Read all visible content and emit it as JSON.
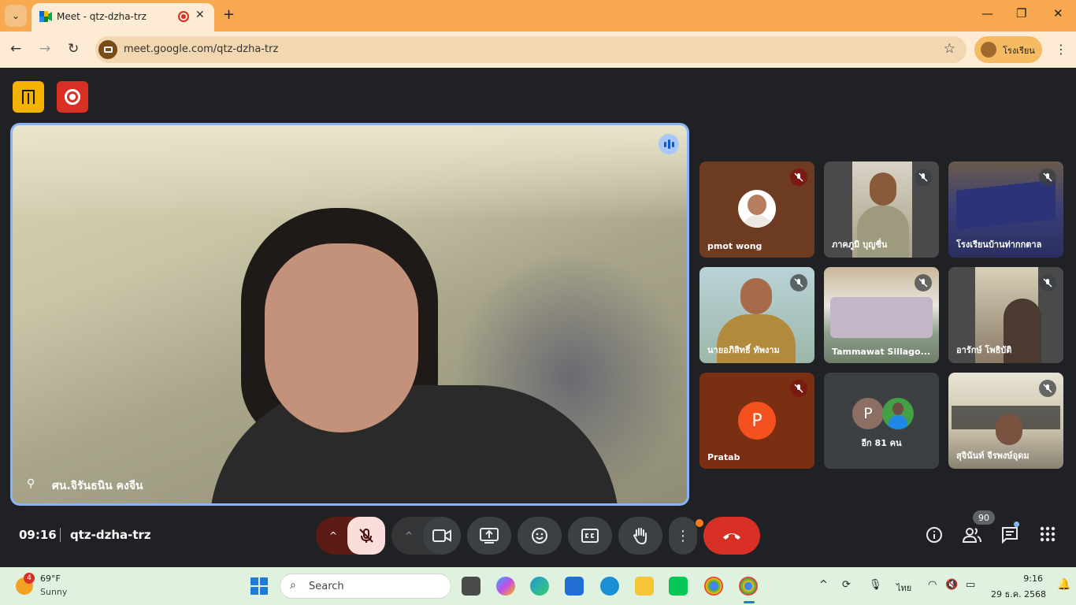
{
  "browser": {
    "tab_title": "Meet - qtz-dzha-trz",
    "tab_close": "✕",
    "new_tab": "+",
    "url": "meet.google.com/qtz-dzha-trz",
    "profile_name": "โรงเรียน",
    "controls": {
      "minimize": "—",
      "maximize": "❐",
      "close": "✕"
    },
    "nav": {
      "back": "←",
      "forward": "→",
      "reload": "↻",
      "star": "☆",
      "menu": "⋮",
      "tab_menu": "⌄"
    }
  },
  "meeting": {
    "time": "09:16",
    "code": "qtz-dzha-trz",
    "main_speaker": "ศน.จิรันธนิน คงจีน",
    "participant_count": "90",
    "participants": [
      {
        "name": "pmot wong",
        "muted": true,
        "avatar": "photo"
      },
      {
        "name": "ภาคภูมิ บุญชื่น",
        "muted": true,
        "avatar": "video"
      },
      {
        "name": "โรงเรียนบ้านท่ากกตาล",
        "muted": true,
        "avatar": "video"
      },
      {
        "name": "นายอภิสิทธิ์ ทัพงาม",
        "muted": true,
        "avatar": "video"
      },
      {
        "name": "Tammawat Sillago...",
        "muted": true,
        "avatar": "video"
      },
      {
        "name": "อารักษ์ โพธิบัติ",
        "muted": true,
        "avatar": "video"
      },
      {
        "name": "Pratab",
        "muted": true,
        "avatar": "letter",
        "letter": "P"
      },
      {
        "name": "อีก 81 คน",
        "muted": false,
        "avatar": "group",
        "letter": "P"
      },
      {
        "name": "สุจินันท์ จีรพงษ์อุดม",
        "muted": true,
        "avatar": "video"
      }
    ],
    "controls": {
      "caret": "^",
      "more": "⋮"
    }
  },
  "taskbar": {
    "weather_badge": "4",
    "temperature": "69°F",
    "condition": "Sunny",
    "search_placeholder": "Search",
    "language": "ไทย",
    "clock_time": "9:16",
    "clock_date": "29 ธ.ค. 2568",
    "tray_caret": "^"
  },
  "colors": {
    "tabbar": "#f8a84f",
    "end_call": "#d93025",
    "speaker_border": "#8ab4f8",
    "record": "#d93025"
  },
  "icons": [
    "meet-favicon",
    "record-dot-icon",
    "door-icon",
    "record-icon",
    "speaking-icon",
    "pin-icon",
    "mic-off-icon",
    "camera-icon",
    "present-icon",
    "emoji-icon",
    "captions-icon",
    "raise-hand-icon",
    "end-call-icon",
    "info-icon",
    "people-icon",
    "chat-icon",
    "apps-icon"
  ]
}
